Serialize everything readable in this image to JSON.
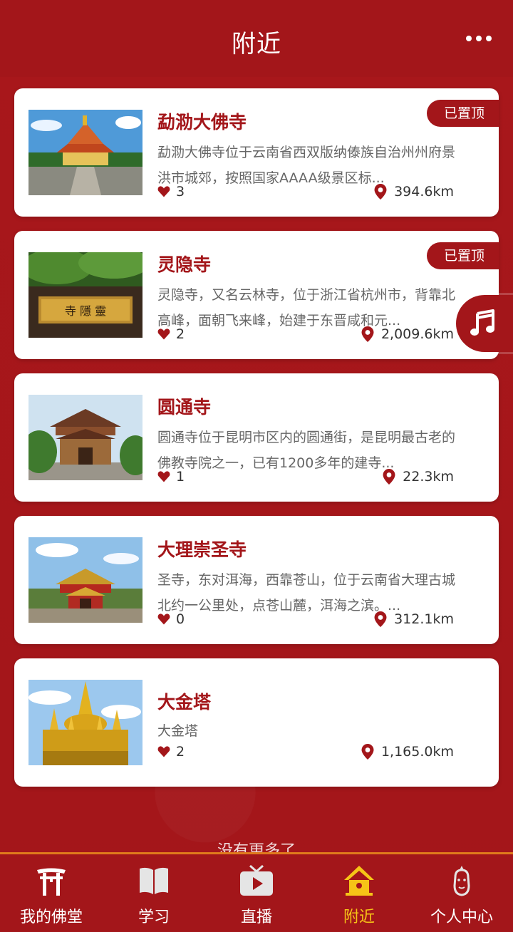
{
  "header": {
    "title": "附近"
  },
  "items": [
    {
      "title": "勐泐大佛寺",
      "desc": "勐泐大佛寺位于云南省西双版纳傣族自治州州府景洪市城郊，按照国家AAAA级景区标...",
      "likes": "3",
      "distance": "394.6km",
      "pinned": "已置顶"
    },
    {
      "title": "灵隐寺",
      "desc": "灵隐寺，又名云林寺，位于浙江省杭州市，背靠北高峰，面朝飞来峰，始建于东晋咸和元...",
      "likes": "2",
      "distance": "2,009.6km",
      "pinned": "已置顶"
    },
    {
      "title": "圆通寺",
      "desc": "圆通寺位于昆明市区内的圆通街，是昆明最古老的佛教寺院之一，已有1200多年的建寺...",
      "likes": "1",
      "distance": "22.3km"
    },
    {
      "title": "大理崇圣寺",
      "desc": "圣寺，东对洱海，西靠苍山，位于云南省大理古城北约一公里处，点苍山麓，洱海之滨。...",
      "likes": "0",
      "distance": "312.1km"
    },
    {
      "title": "大金塔",
      "desc": "大金塔",
      "likes": "2",
      "distance": "1,165.0km"
    }
  ],
  "footer_text": "没有更多了",
  "tabs": [
    {
      "label": "我的佛堂",
      "icon": "torii-gate-icon"
    },
    {
      "label": "学习",
      "icon": "book-icon"
    },
    {
      "label": "直播",
      "icon": "tv-play-icon"
    },
    {
      "label": "附近",
      "icon": "temple-icon"
    },
    {
      "label": "个人中心",
      "icon": "buddha-icon"
    }
  ],
  "colors": {
    "primary": "#a3161a",
    "active": "#f6c417",
    "accent_border": "#e07a1c"
  }
}
